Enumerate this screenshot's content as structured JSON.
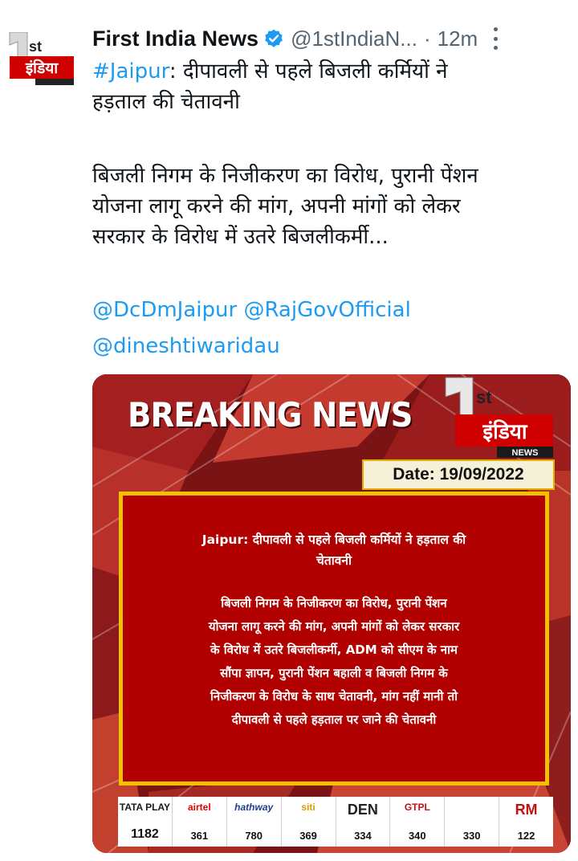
{
  "tweet": {
    "author": {
      "name": "First India News",
      "handle": "@1stIndiaN...",
      "separator": "·",
      "time": "12m",
      "verified": true,
      "avatar_icon": "first-india-news-logo",
      "avatar_text": "इंडिया"
    },
    "hashtag": "#Jaipur",
    "line1_rest": ": दीपावली से पहले बिजली कर्मियों ने",
    "line2": "हड़ताल की चेतावनी",
    "para2": [
      "बिजली निगम के निजीकरण का विरोध, पुरानी पेंशन",
      "योजना लागू करने की मांग, अपनी मांगों को लेकर",
      "सरकार के विरोध में उतरे बिजलीकर्मी..."
    ],
    "mentions_line1": [
      "@DcDmJaipur",
      "@RajGovOfficial"
    ],
    "mentions_line2": [
      "@dineshtiwaridau"
    ]
  },
  "card": {
    "breaking": "BREAKING NEWS",
    "logo_text": "इंडिया",
    "logo_sub": "NEWS",
    "date": "Date: 19/09/2022",
    "headline_lines": [
      "Jaipur: दीपावली से पहले बिजली कर्मियों ने हड़ताल की",
      "चेतावनी"
    ],
    "body_lines": [
      "बिजली निगम के निजीकरण का विरोध, पुरानी पेंशन",
      "योजना लागू करने की मांग, अपनी मांगों को लेकर सरकार",
      "के विरोध में उतरे बिजलीकर्मी, ADM को सीएम के नाम",
      "सौंपा ज्ञापन, पुरानी पेंशन बहाली व बिजली निगम के",
      "निजीकरण के विरोध के साथ चेतावनी, मांग नहीं मानी तो",
      "दीपावली से पहले हड़ताल पर जाने की चेतावनी"
    ],
    "channels": [
      {
        "brand": "TATA PLAY",
        "number": "1182",
        "color": "#1a1a1a"
      },
      {
        "brand": "airtel",
        "number": "361",
        "color": "#e40000"
      },
      {
        "brand": "hathway",
        "number": "780",
        "color": "#1f3f8f"
      },
      {
        "brand": "siti",
        "number": "369",
        "color": "#d99a00"
      },
      {
        "brand": "DEN",
        "number": "334",
        "color": "#222222"
      },
      {
        "brand": "GTPL",
        "number": "340",
        "color": "#c01010"
      },
      {
        "brand": "",
        "number": "330",
        "color": "#1a5fb4"
      },
      {
        "brand": "RM",
        "number": "122",
        "color": "#c01010"
      }
    ]
  },
  "colors": {
    "link": "#1d9bf0",
    "secondary_text": "#536471",
    "card_red": "#b00000",
    "card_border": "#f2c200"
  }
}
